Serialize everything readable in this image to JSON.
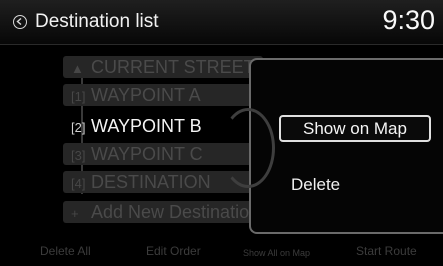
{
  "header": {
    "title": "Destination list",
    "time": "9:30"
  },
  "list": {
    "rows": [
      {
        "icon": "▲",
        "label": "CURRENT STREET"
      },
      {
        "icon": "[1]",
        "label": "WAYPOINT A"
      },
      {
        "icon": "[2]",
        "label": "WAYPOINT B"
      },
      {
        "icon": "[3]",
        "label": "WAYPOINT C"
      },
      {
        "icon": "[4]",
        "label": "DESTINATION"
      },
      {
        "icon": "+",
        "label": "Add New Destination"
      }
    ]
  },
  "popup": {
    "show_on_map": "Show on Map",
    "delete": "Delete"
  },
  "bottom": {
    "delete_all": "Delete All",
    "edit_order": "Edit Order",
    "show_all_on_map": "Show All on Map",
    "start_route": "Start Route"
  }
}
